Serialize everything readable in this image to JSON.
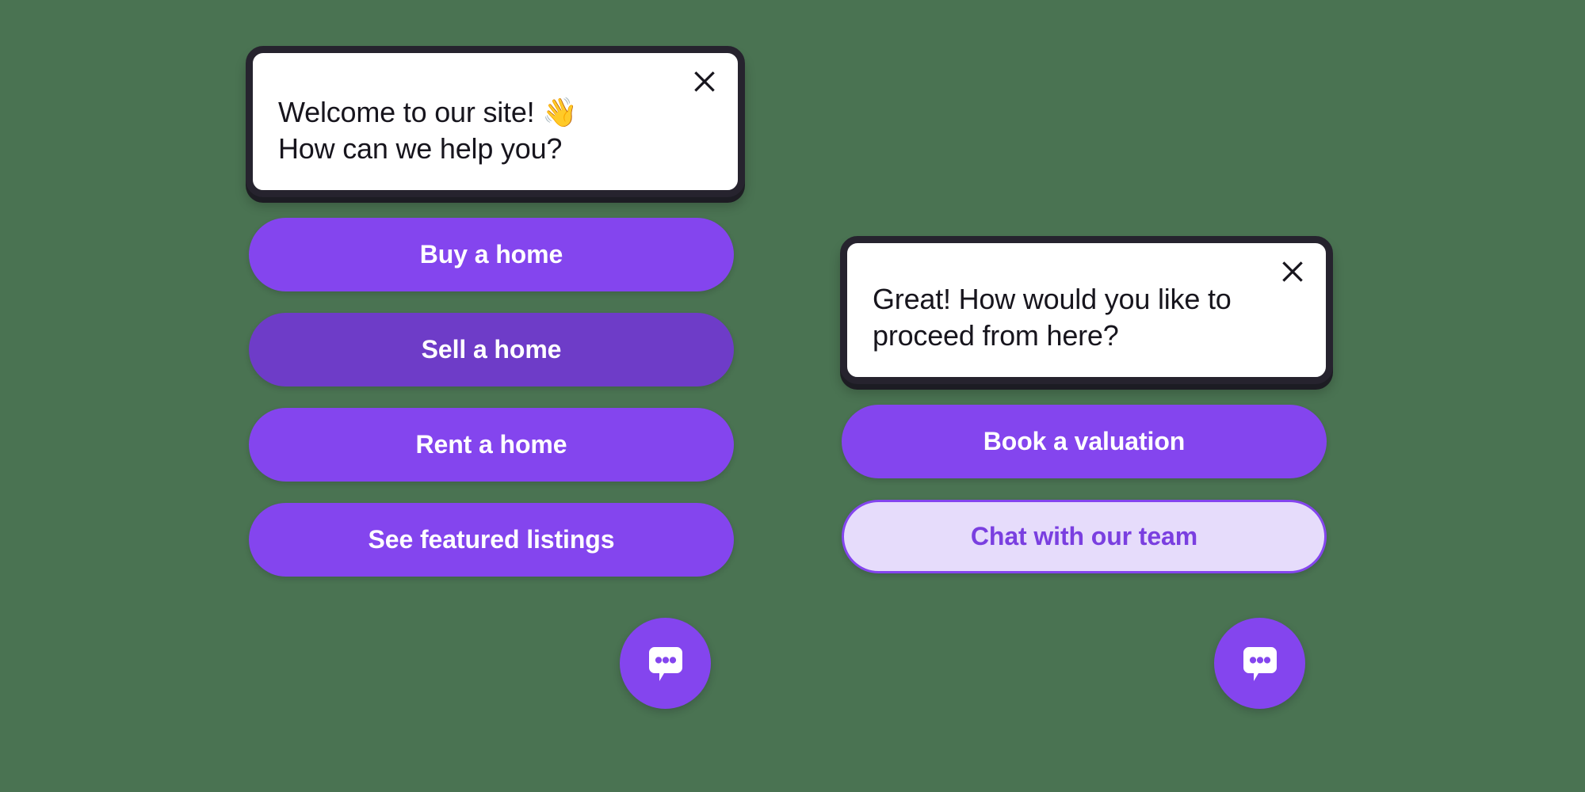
{
  "theme": {
    "background": "#4a7352",
    "primary_purple": "#8445ee",
    "primary_purple_active": "#6e3cc8",
    "secondary_fill": "#e6dcfb",
    "secondary_text": "#7a3fe0",
    "card_border": "#26232e",
    "card_background": "#ffffff",
    "message_text": "#17151d"
  },
  "widgets": [
    {
      "id": "welcome",
      "close_icon": "close-icon",
      "message": "Welcome to our site! 👋\nHow can we help you?",
      "options": [
        {
          "label": "Buy a home",
          "style": "primary"
        },
        {
          "label": "Sell a home",
          "style": "primary-active"
        },
        {
          "label": "Rent a home",
          "style": "primary"
        },
        {
          "label": "See featured listings",
          "style": "primary"
        }
      ],
      "launcher_icon": "chat-bubble-icon"
    },
    {
      "id": "proceed",
      "close_icon": "close-icon",
      "message": "Great! How would you like to\nproceed from here?",
      "options": [
        {
          "label": "Book a valuation",
          "style": "primary"
        },
        {
          "label": "Chat with our team",
          "style": "secondary"
        }
      ],
      "launcher_icon": "chat-bubble-icon"
    }
  ]
}
